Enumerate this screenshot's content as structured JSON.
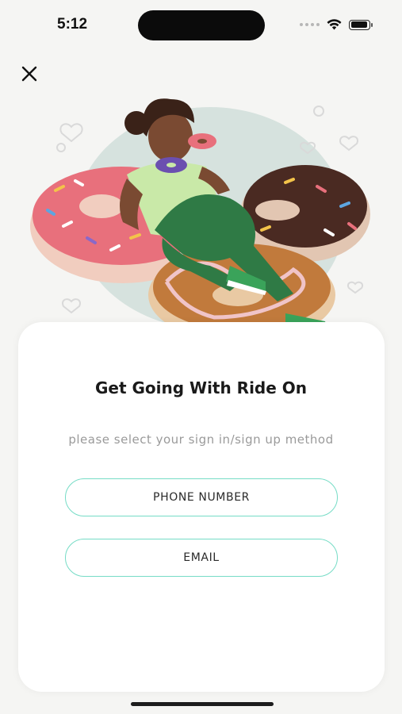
{
  "status": {
    "time": "5:12",
    "icons": [
      "signal-dots-icon",
      "wifi-icon",
      "battery-icon"
    ]
  },
  "nav": {
    "close_icon": "close-icon"
  },
  "illustration": {
    "subject": "person-eating-donuts"
  },
  "main": {
    "title": "Get Going With Ride On",
    "subtitle": "please select your sign in/sign up method",
    "buttons": {
      "phone": "PHONE NUMBER",
      "email": "EMAIL"
    }
  },
  "colors": {
    "accent_border": "#76dcc6",
    "background": "#f5f5f3",
    "card": "#ffffff"
  }
}
